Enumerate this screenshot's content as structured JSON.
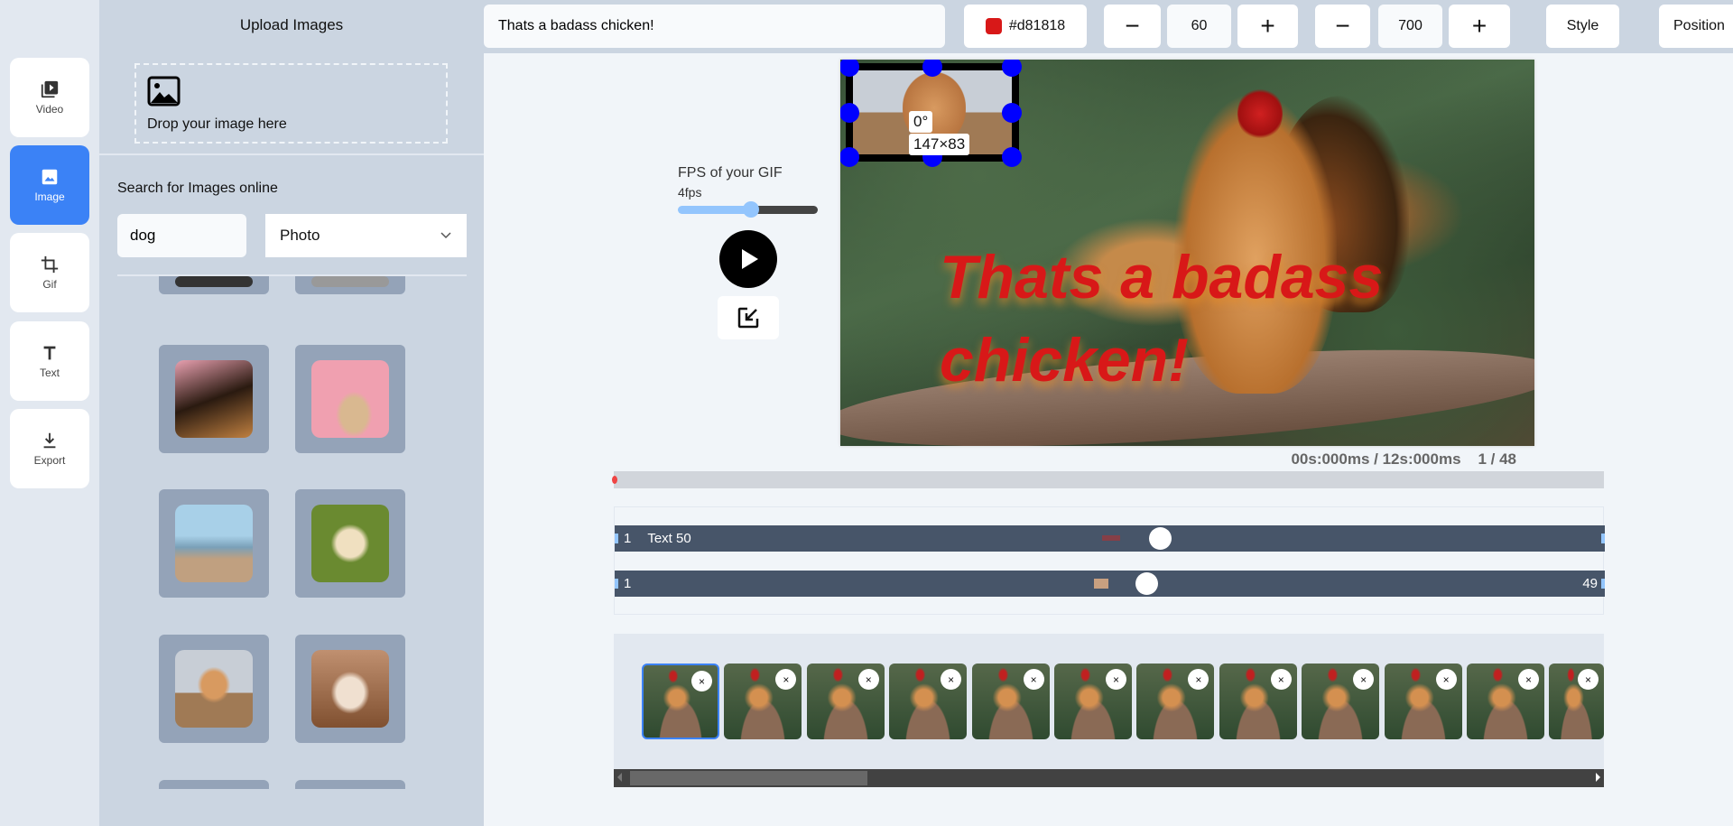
{
  "rail": [
    {
      "label": "Video",
      "icon": "video-library-icon"
    },
    {
      "label": "Image",
      "icon": "image-icon",
      "active": true
    },
    {
      "label": "Gif",
      "icon": "crop-icon"
    },
    {
      "label": "Text",
      "icon": "text-icon"
    },
    {
      "label": "Export",
      "icon": "download-icon"
    }
  ],
  "panel": {
    "title": "Upload Images",
    "drop_label": "Drop your image here",
    "search_label": "Search for Images online",
    "search_value": "dog",
    "type_value": "Photo"
  },
  "toolbar": {
    "text_value": "Thats a badass chicken!",
    "color": "#d81818",
    "color_label": "#d81818",
    "size_value": "60",
    "weight_value": "700",
    "minus": "−",
    "plus": "+",
    "style_label": "Style",
    "position_label": "Position"
  },
  "canvas": {
    "caption": "Thats a badass chicken!",
    "overlay_angle": "0°",
    "overlay_size": "147×83"
  },
  "fps": {
    "label": "FPS of your GIF",
    "value": "4fps",
    "fraction": 0.45
  },
  "timeline": {
    "time": "00s:000ms / 12s:000ms",
    "frame": "1 / 48",
    "tracks": [
      {
        "start": "1",
        "name": "Text 50",
        "end": ""
      },
      {
        "start": "1",
        "name": "",
        "end": "49"
      }
    ]
  },
  "frames": [
    {
      "selected": true
    },
    {},
    {},
    {},
    {},
    {},
    {},
    {},
    {},
    {},
    {},
    {}
  ],
  "frame_delete": "×"
}
